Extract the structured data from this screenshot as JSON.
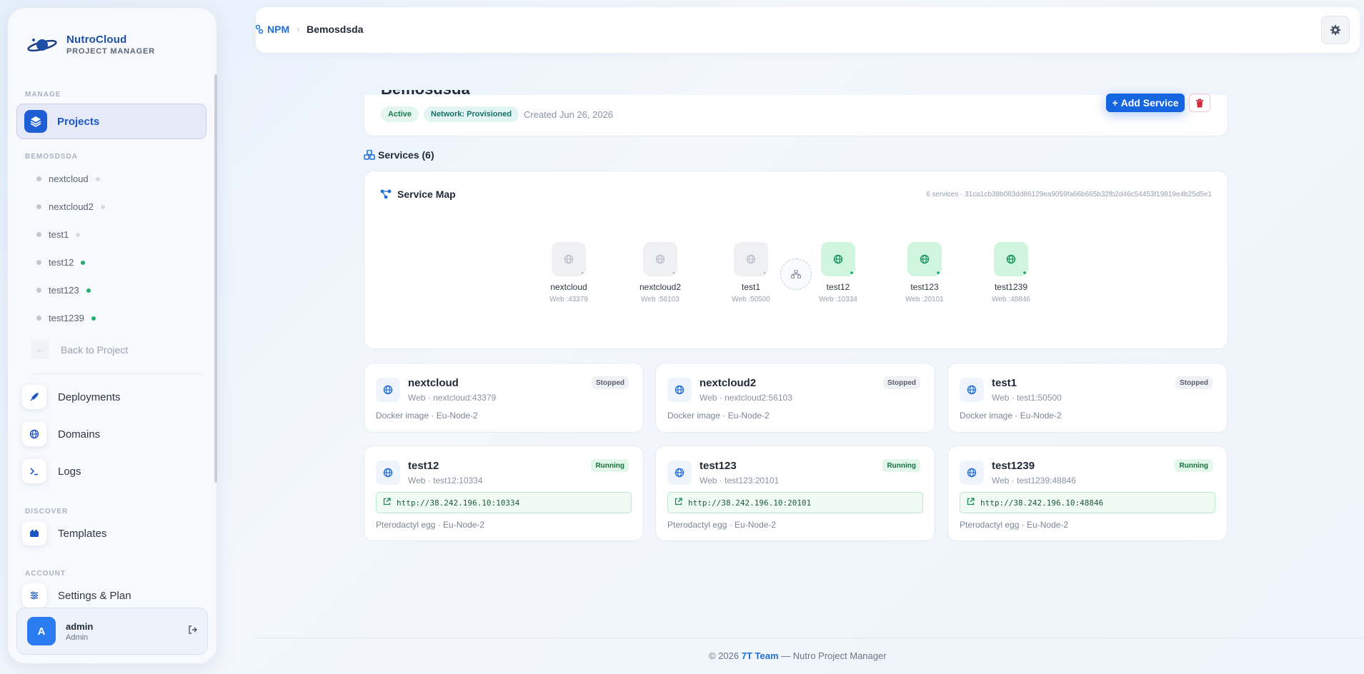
{
  "brand": {
    "name": "NutroCloud",
    "subtitle": "PROJECT MANAGER"
  },
  "sidebar": {
    "manage_label": "MANAGE",
    "projects_label": "Projects",
    "project_section_label": "BEMOSDSDA",
    "services": [
      {
        "name": "nextcloud",
        "status": "stopped"
      },
      {
        "name": "nextcloud2",
        "status": "stopped"
      },
      {
        "name": "test1",
        "status": "stopped"
      },
      {
        "name": "test12",
        "status": "running"
      },
      {
        "name": "test123",
        "status": "running"
      },
      {
        "name": "test1239",
        "status": "running"
      }
    ],
    "back_label": "Back to Project",
    "nav": {
      "deployments": "Deployments",
      "domains": "Domains",
      "logs": "Logs"
    },
    "discover_label": "DISCOVER",
    "templates_label": "Templates",
    "account_label": "ACCOUNT",
    "settings_label": "Settings & Plan",
    "user": {
      "initial": "A",
      "name": "admin",
      "role": "Admin"
    }
  },
  "breadcrumb": {
    "root": "NPM",
    "current": "Bemosdsda"
  },
  "project": {
    "title": "Bemosdsda",
    "status": "Active",
    "network": "Network: Provisioned",
    "created": "Created Jun 26, 2026",
    "add_service_label": "Add Service"
  },
  "services_header": "Services (6)",
  "service_map": {
    "title": "Service Map",
    "meta": "6 services · 31ca1cb38b083dd86129ea9059fa66b665b32fb2d46c54453f19819e4b25d5e1",
    "nodes": [
      {
        "name": "nextcloud",
        "sub": "Web :43379",
        "status": "stopped"
      },
      {
        "name": "nextcloud2",
        "sub": "Web :56103",
        "status": "stopped"
      },
      {
        "name": "test1",
        "sub": "Web :50500",
        "status": "stopped"
      },
      {
        "name": "test12",
        "sub": "Web :10334",
        "status": "running"
      },
      {
        "name": "test123",
        "sub": "Web :20101",
        "status": "running"
      },
      {
        "name": "test1239",
        "sub": "Web :48846",
        "status": "running"
      }
    ]
  },
  "cards": [
    {
      "name": "nextcloud",
      "sub": "Web · nextcloud:43379",
      "badge": "Stopped",
      "footer": "Docker image · Eu-Node-2",
      "url": ""
    },
    {
      "name": "nextcloud2",
      "sub": "Web · nextcloud2:56103",
      "badge": "Stopped",
      "footer": "Docker image · Eu-Node-2",
      "url": ""
    },
    {
      "name": "test1",
      "sub": "Web · test1:50500",
      "badge": "Stopped",
      "footer": "Docker image · Eu-Node-2",
      "url": ""
    },
    {
      "name": "test12",
      "sub": "Web · test12:10334",
      "badge": "Running",
      "footer": "Pterodactyl egg · Eu-Node-2",
      "url": "http://38.242.196.10:10334"
    },
    {
      "name": "test123",
      "sub": "Web · test123:20101",
      "badge": "Running",
      "footer": "Pterodactyl egg · Eu-Node-2",
      "url": "http://38.242.196.10:20101"
    },
    {
      "name": "test1239",
      "sub": "Web · test1239:48846",
      "badge": "Running",
      "footer": "Pterodactyl egg · Eu-Node-2",
      "url": "http://38.242.196.10:48846"
    }
  ],
  "footer": {
    "copyright": "© 2026",
    "team": "7T Team",
    "suffix": "— Nutro Project Manager"
  },
  "colors": {
    "accent": "#1565e0",
    "running": "#22b070",
    "stopped": "#c8cdd6"
  }
}
